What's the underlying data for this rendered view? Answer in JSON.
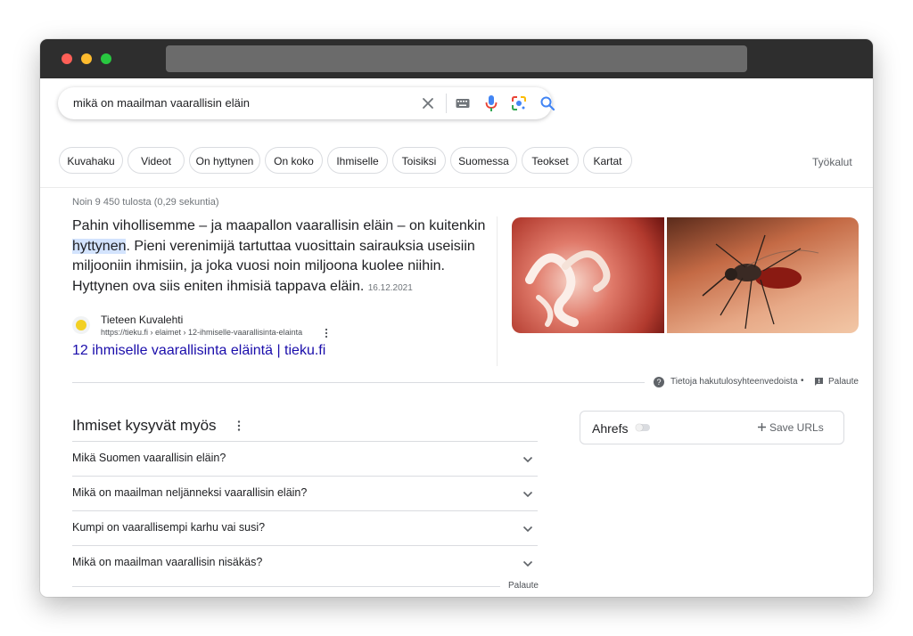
{
  "search": {
    "query": "mikä on maailman vaarallisin eläin"
  },
  "chips": [
    "Kuvahaku",
    "Videot",
    "On hyttynen",
    "On koko",
    "Ihmiselle",
    "Toisiksi",
    "Suomessa",
    "Teokset",
    "Kartat"
  ],
  "tools_label": "Työkalut",
  "stats": "Noin 9 450 tulosta (0,29 sekuntia)",
  "featured": {
    "text_before": "Pahin vihollisemme – ja maapallon vaarallisin eläin – on kuitenkin ",
    "highlight": "hyttynen",
    "text_after": ". Pieni verenimijä tartuttaa vuosittain sairauksia useisiin miljooniin ihmisiin, ja joka vuosi noin miljoona kuolee niihin. Hyttynen ova siis eniten ihmisiä tappava eläin.",
    "date": "16.12.2021",
    "source_name": "Tieteen Kuvalehti",
    "source_url": "https://tieku.fi › elaimet › 12-ihmiselle-vaarallisinta-elainta",
    "link_title": "12 ihmiselle vaarallisinta eläintä | tieku.fi"
  },
  "about_snippets": "Tietoja hakutulosyhteenvedoista",
  "middot": "•",
  "feedback": "Palaute",
  "paa": {
    "title": "Ihmiset kysyvät myös",
    "questions": [
      "Mikä Suomen vaarallisin eläin?",
      "Mikä on maailman neljänneksi vaarallisin eläin?",
      "Kumpi on vaarallisempi karhu vai susi?",
      "Mikä on maailman vaarallisin nisäkäs?"
    ],
    "feedback": "Palaute"
  },
  "ahrefs": {
    "title": "Ahrefs",
    "save_label": "Save URLs"
  }
}
